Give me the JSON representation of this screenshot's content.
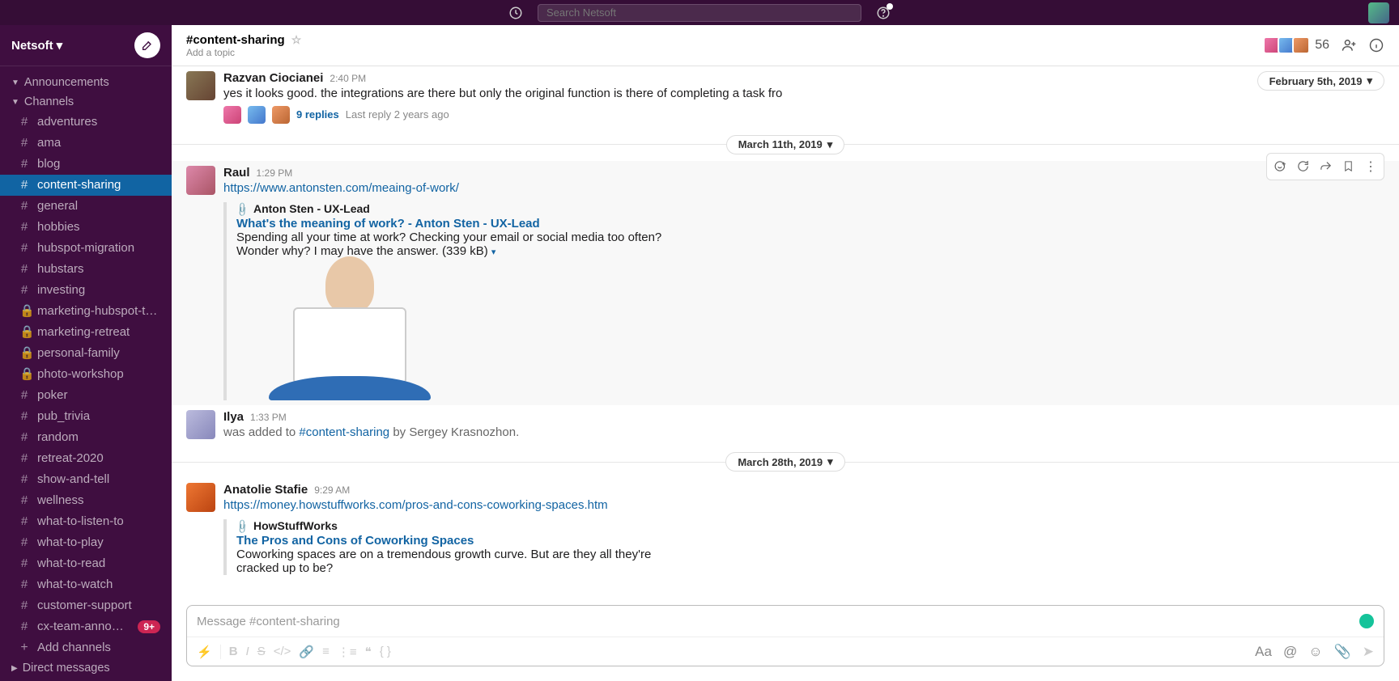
{
  "app": {
    "search_placeholder": "Search Netsoft",
    "workspace": "Netsoft"
  },
  "sidebar": {
    "sections": {
      "announcements": "Announcements",
      "channels": "Channels",
      "dms": "Direct messages",
      "add": "Add channels"
    },
    "channels": [
      {
        "name": "adventures",
        "prefix": "#"
      },
      {
        "name": "ama",
        "prefix": "#"
      },
      {
        "name": "blog",
        "prefix": "#"
      },
      {
        "name": "content-sharing",
        "prefix": "#",
        "active": true
      },
      {
        "name": "general",
        "prefix": "#"
      },
      {
        "name": "hobbies",
        "prefix": "#"
      },
      {
        "name": "hubspot-migration",
        "prefix": "#"
      },
      {
        "name": "hubstars",
        "prefix": "#"
      },
      {
        "name": "investing",
        "prefix": "#"
      },
      {
        "name": "marketing-hubspot-transiti...",
        "prefix": "lock"
      },
      {
        "name": "marketing-retreat",
        "prefix": "lock"
      },
      {
        "name": "personal-family",
        "prefix": "lock"
      },
      {
        "name": "photo-workshop",
        "prefix": "lock"
      },
      {
        "name": "poker",
        "prefix": "#"
      },
      {
        "name": "pub_trivia",
        "prefix": "#"
      },
      {
        "name": "random",
        "prefix": "#"
      },
      {
        "name": "retreat-2020",
        "prefix": "#"
      },
      {
        "name": "show-and-tell",
        "prefix": "#"
      },
      {
        "name": "wellness",
        "prefix": "#"
      },
      {
        "name": "what-to-listen-to",
        "prefix": "#"
      },
      {
        "name": "what-to-play",
        "prefix": "#"
      },
      {
        "name": "what-to-read",
        "prefix": "#"
      },
      {
        "name": "what-to-watch",
        "prefix": "#"
      },
      {
        "name": "customer-support",
        "prefix": "#"
      },
      {
        "name": "cx-team-announcem...",
        "prefix": "#",
        "badge": "9+"
      }
    ]
  },
  "header": {
    "channel": "#content-sharing",
    "topic": "Add a topic",
    "member_count": "56"
  },
  "dates": {
    "feb": "February 5th, 2019",
    "mar11": "March 11th, 2019",
    "mar28": "March 28th, 2019"
  },
  "messages": {
    "m0": {
      "author": "Razvan Ciocianei",
      "time": "2:40 PM",
      "text": "yes it looks good. the integrations are there but only the original function is there of completing a task fro",
      "replies": "9 replies",
      "last": "Last reply 2 years ago"
    },
    "m1": {
      "author": "Raul",
      "time": "1:29 PM",
      "link": "https://www.antonsten.com/meaing-of-work/",
      "site": "Anton Sten - UX-Lead",
      "title": "What's the meaning of work? - Anton Sten - UX-Lead",
      "desc": "Spending all your time at work? Checking your email or social media too often? Wonder why? I may have the answer. (339 kB)"
    },
    "m2": {
      "author": "Ilya",
      "time": "1:33 PM",
      "pre": "was added to ",
      "chan": "#content-sharing",
      "post": " by Sergey Krasnozhon."
    },
    "m3": {
      "author": "Anatolie Stafie",
      "time": "9:29 AM",
      "link": "https://money.howstuffworks.com/pros-and-cons-coworking-spaces.htm",
      "site": "HowStuffWorks",
      "title": "The Pros and Cons of Coworking Spaces",
      "desc": "Coworking spaces are on a tremendous growth curve. But are they all they're cracked up to be?"
    }
  },
  "composer": {
    "placeholder": "Message #content-sharing"
  }
}
